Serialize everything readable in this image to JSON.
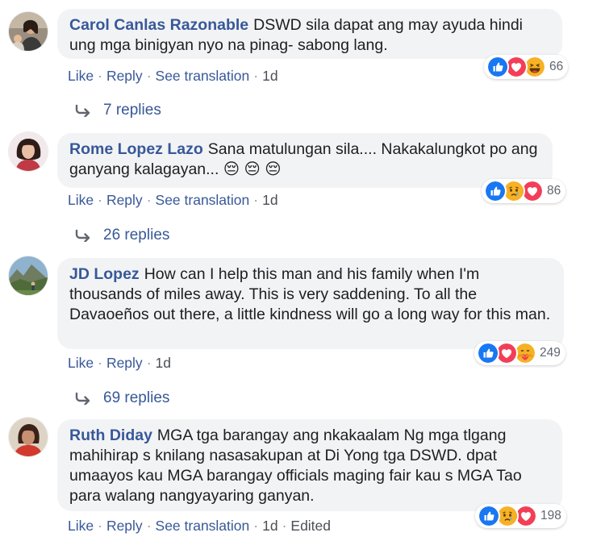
{
  "actions": {
    "like": "Like",
    "reply": "Reply",
    "see_translation": "See translation",
    "separator": "·",
    "edited": "Edited"
  },
  "comments": [
    {
      "author": "Carol Canlas Razonable",
      "text": "DSWD sila dapat ang may ayuda hindi ung mga binigyan nyo na pinag- sabong lang.",
      "time": "1d",
      "reaction_count": "66",
      "reactions": [
        "like",
        "love",
        "haha"
      ],
      "replies": "7 replies"
    },
    {
      "author": "Rome Lopez Lazo",
      "text": "Sana matulungan sila.... Nakakalungkot po ang ganyang kalagayan... 😔 😔 😔",
      "time": "1d",
      "reaction_count": "86",
      "reactions": [
        "like",
        "sad",
        "love"
      ],
      "replies": "26 replies"
    },
    {
      "author": "JD Lopez",
      "text": "How can I help this man and his family when I'm thousands of miles away. This is very saddening. To all the Davaoeños out there, a little kindness will go a long way for this man.",
      "time": "1d",
      "reaction_count": "249",
      "reactions": [
        "like",
        "love",
        "care"
      ],
      "replies": "69 replies"
    },
    {
      "author": "Ruth Diday",
      "text": "MGA tga barangay ang nkakaalam Ng mga tlgang mahihirap s knilang nasasakupan at Di Yong tga DSWD. dpat umaayos kau MGA barangay officials maging fair kau s MGA Tao para walang nangyayaring ganyan.",
      "time": "1d",
      "reaction_count": "198",
      "reactions": [
        "like",
        "sad",
        "love"
      ]
    }
  ],
  "colors": {
    "link": "#385898",
    "bubble": "#f2f3f5",
    "like": "#1877f2",
    "love": "#f33e58",
    "emoji": "#f7b125"
  }
}
